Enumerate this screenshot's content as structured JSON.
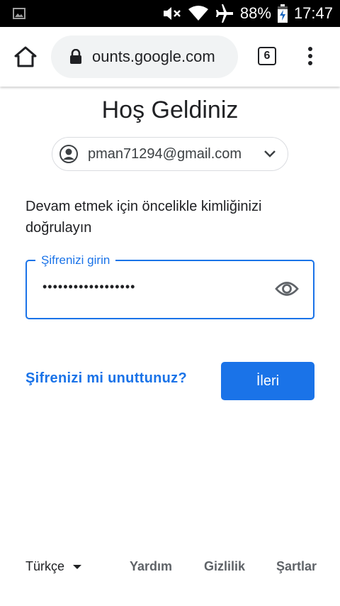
{
  "status_bar": {
    "battery": "88%",
    "time": "17:47",
    "icons": [
      "image-icon",
      "mute-icon",
      "wifi-icon",
      "airplane-icon",
      "battery-charging-icon"
    ]
  },
  "browser": {
    "url": "ounts.google.com",
    "tab_count": "6",
    "icons": [
      "home-icon",
      "lock-icon",
      "overflow-menu-icon"
    ]
  },
  "page": {
    "title": "Hoş Geldiniz",
    "account_email": "pman71294@gmail.com",
    "prompt": "Devam etmek için öncelikle kimliğinizi doğrulayın",
    "password_label": "Şifrenizi girin",
    "password_mask": "••••••••••••••••••",
    "forgot_link": "Şifrenizi mi unuttunuz?",
    "next_button": "İleri"
  },
  "footer": {
    "language": "Türkçe",
    "help": "Yardım",
    "privacy": "Gizlilik",
    "terms": "Şartlar"
  },
  "colors": {
    "accent": "#1a73e8",
    "text": "#202124",
    "muted": "#5f6368",
    "status_bar": "#000000"
  }
}
